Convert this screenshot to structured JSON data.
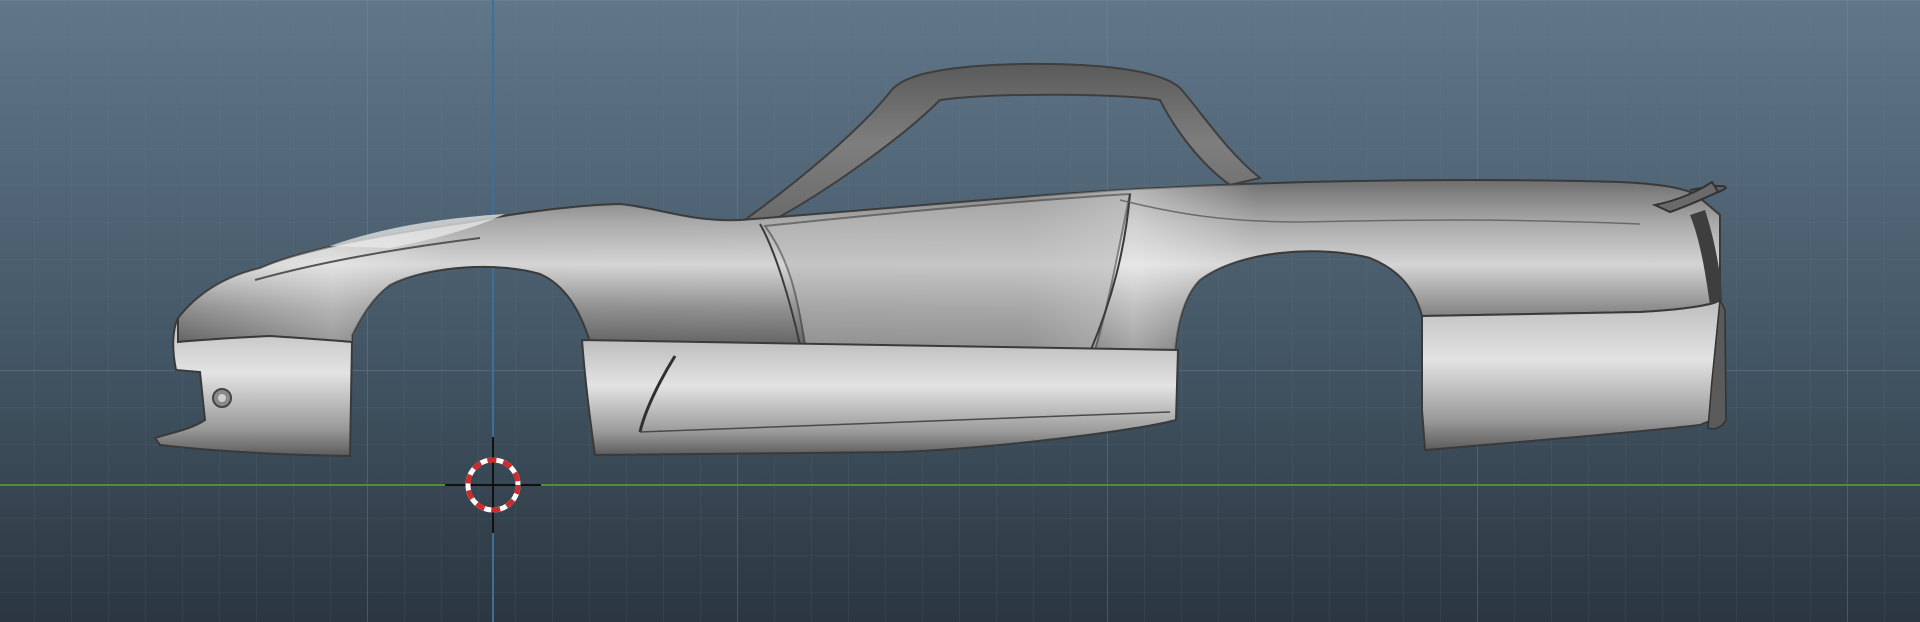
{
  "viewport": {
    "view": "side-orthographic",
    "background_top": "#5f7585",
    "background_bottom": "#2c3841",
    "grid_minor_color": "#6b8090",
    "grid_major_color": "#7a8e9c",
    "axis_x_color": "#4c8f2a",
    "axis_z_color": "#3b6f9a"
  },
  "model": {
    "name": "car-body-shell",
    "body_color": "#9a9a9a",
    "shadow_color": "#4a4a4a",
    "highlight_color": "#e8e8e8"
  },
  "cursor_3d": {
    "name": "3d-cursor",
    "ring_color_a": "#ffffff",
    "ring_color_b": "#d22b2b",
    "crosshair_color": "#111111"
  }
}
